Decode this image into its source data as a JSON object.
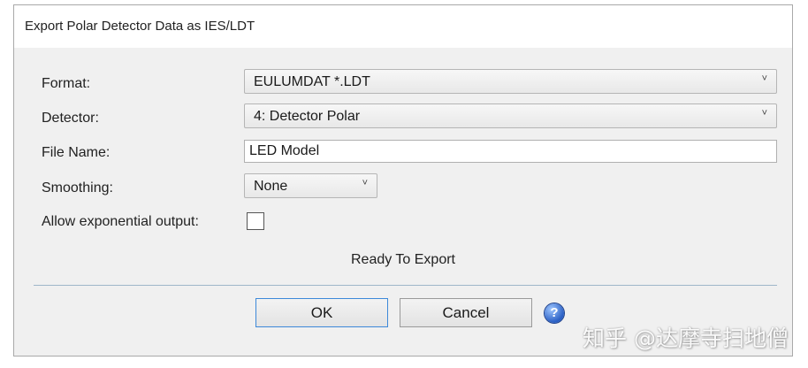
{
  "dialog": {
    "title": "Export Polar Detector Data as IES/LDT",
    "status": "Ready To Export"
  },
  "form": {
    "format_label": "Format:",
    "format_value": "EULUMDAT *.LDT",
    "detector_label": "Detector:",
    "detector_value": "4: Detector Polar",
    "filename_label": "File Name:",
    "filename_value": "LED Model",
    "smoothing_label": "Smoothing:",
    "smoothing_value": "None",
    "exponential_label": "Allow exponential output:",
    "exponential_checked": false,
    "chevron": "˅"
  },
  "buttons": {
    "ok_label": "OK",
    "cancel_label": "Cancel",
    "help_icon": "help-icon",
    "help_glyph": "?"
  },
  "watermark": "知乎 @达摩寺扫地僧",
  "colors": {
    "dialog_bg": "#f0f0f0",
    "ok_border": "#3d89d9",
    "help_blue": "#2a5fc4"
  }
}
